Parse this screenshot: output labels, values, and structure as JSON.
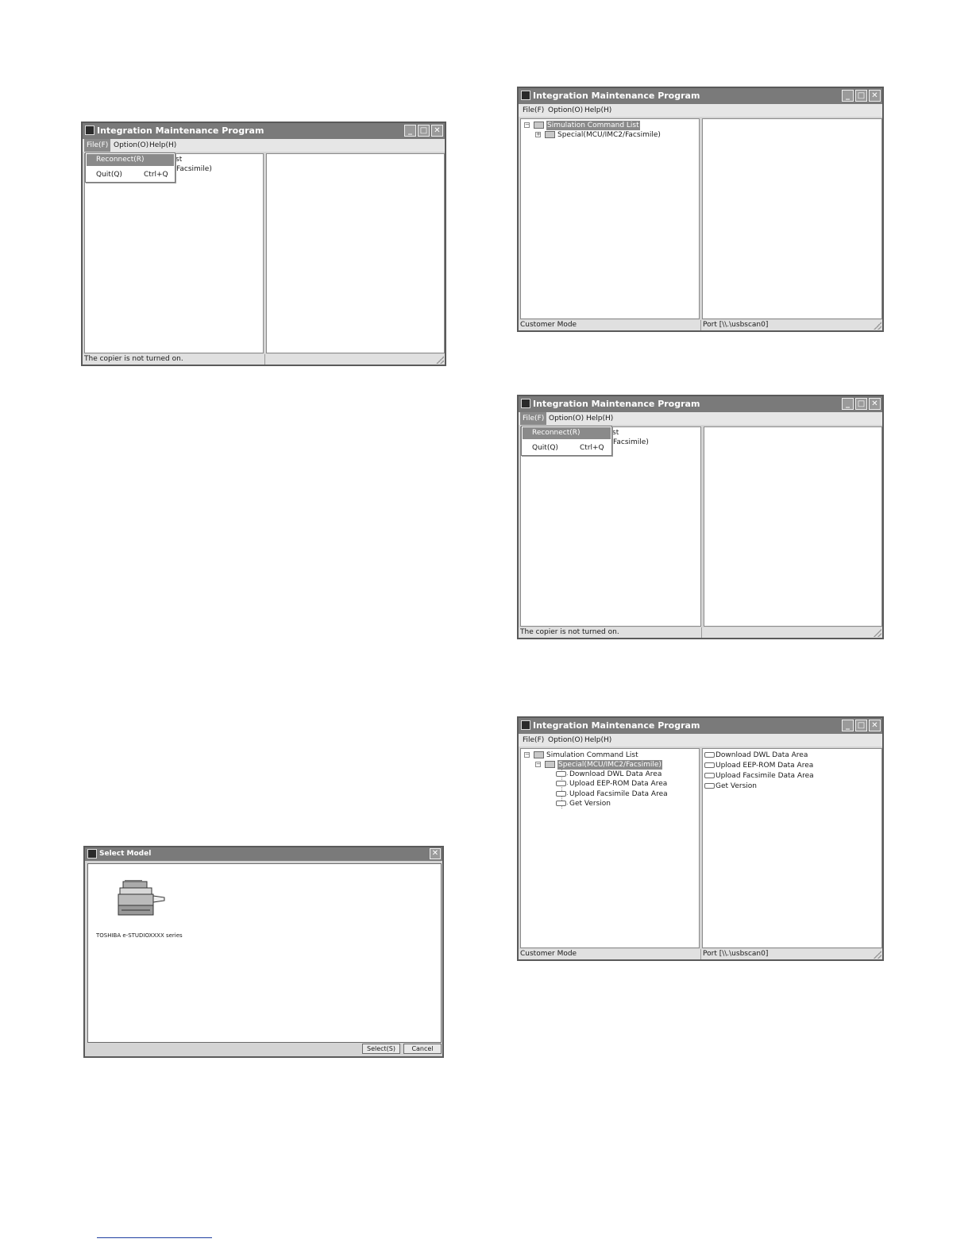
{
  "windows": {
    "main_title": "Integration Maintenance Program",
    "select_model_title": "Select Model"
  },
  "menubar": {
    "file": "File(F)",
    "option": "Option(O)",
    "help": "Help(H)"
  },
  "title_buttons": {
    "minimize": "_",
    "maximize": "□",
    "close": "✕"
  },
  "file_menu": {
    "reconnect": "Reconnect(R)",
    "quit": "Quit(Q)",
    "quit_accel": "Ctrl+Q"
  },
  "tree": {
    "root": "Simulation Command List",
    "special": "Special(MCU/IMC2/Facsimile)",
    "expand_plus": "+",
    "expand_minus": "−",
    "root_fragment": "st",
    "special_fragment": "/Facsimile)",
    "children": [
      "Download DWL Data Area",
      "Upload EEP-ROM Data Area",
      "Upload Facsimile Data Area",
      "Get Version"
    ]
  },
  "status": {
    "copier_off": "The copier is not turned on.",
    "customer_mode": "Customer Mode",
    "port": "Port [\\\\.\\usbscan0]"
  },
  "select_model": {
    "model_name": "TOSHIBA e-STUDIOXXXX series",
    "select_button": "Select(S)",
    "cancel_button": "Cancel"
  },
  "colors": {
    "titlebar": "#7a7a7a",
    "highlight": "#8a8a8a",
    "footer_rule": "#1f3fa0"
  }
}
